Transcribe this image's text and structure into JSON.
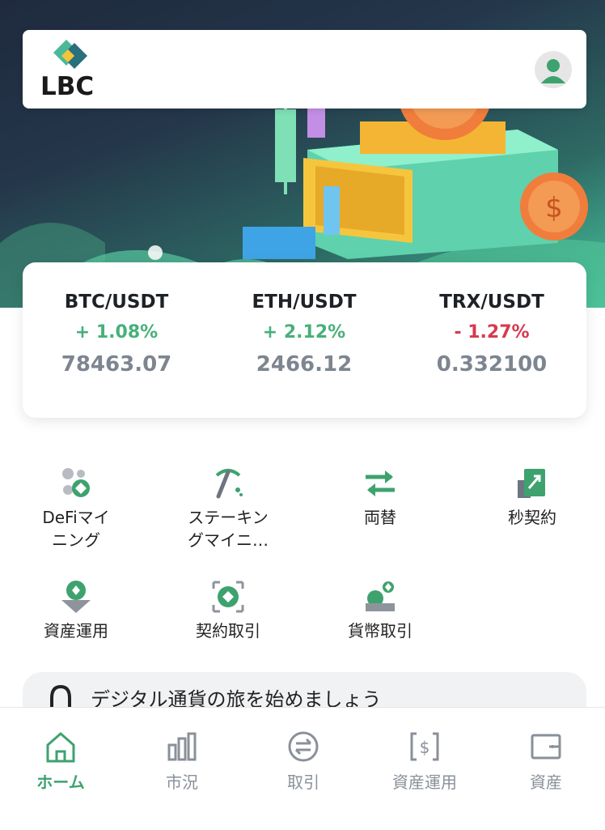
{
  "app": {
    "brand": "LBC",
    "colors": {
      "accent": "#3ea26f",
      "up": "#48b07a",
      "down": "#d63a4f"
    }
  },
  "tickers": [
    {
      "pair": "BTC/USDT",
      "change": "+ 1.08%",
      "direction": "up",
      "price": "78463.07"
    },
    {
      "pair": "ETH/USDT",
      "change": "+ 2.12%",
      "direction": "up",
      "price": "2466.12"
    },
    {
      "pair": "TRX/USDT",
      "change": "- 1.27%",
      "direction": "down",
      "price": "0.332100"
    }
  ],
  "features": [
    {
      "label": "DeFiマイ\nニング",
      "icon": "defi-mining-icon"
    },
    {
      "label": "ステーキン\nグマイニ…",
      "icon": "pickaxe-icon"
    },
    {
      "label": "両替",
      "icon": "exchange-arrows-icon"
    },
    {
      "label": "秒契約",
      "icon": "contract-chart-icon"
    },
    {
      "label": "資産運用",
      "icon": "asset-management-icon"
    },
    {
      "label": "契約取引",
      "icon": "contract-trade-icon"
    },
    {
      "label": "貨幣取引",
      "icon": "coin-trade-icon"
    }
  ],
  "notice": {
    "text": "デジタル通貨の旅を始めましょう",
    "icon": "bell-icon"
  },
  "bottom_nav": [
    {
      "label": "ホーム",
      "icon": "home-icon",
      "active": true
    },
    {
      "label": "市況",
      "icon": "bar-chart-icon",
      "active": false
    },
    {
      "label": "取引",
      "icon": "swap-circle-icon",
      "active": false
    },
    {
      "label": "資産運用",
      "icon": "dollar-doc-icon",
      "active": false
    },
    {
      "label": "資産",
      "icon": "wallet-icon",
      "active": false
    }
  ]
}
